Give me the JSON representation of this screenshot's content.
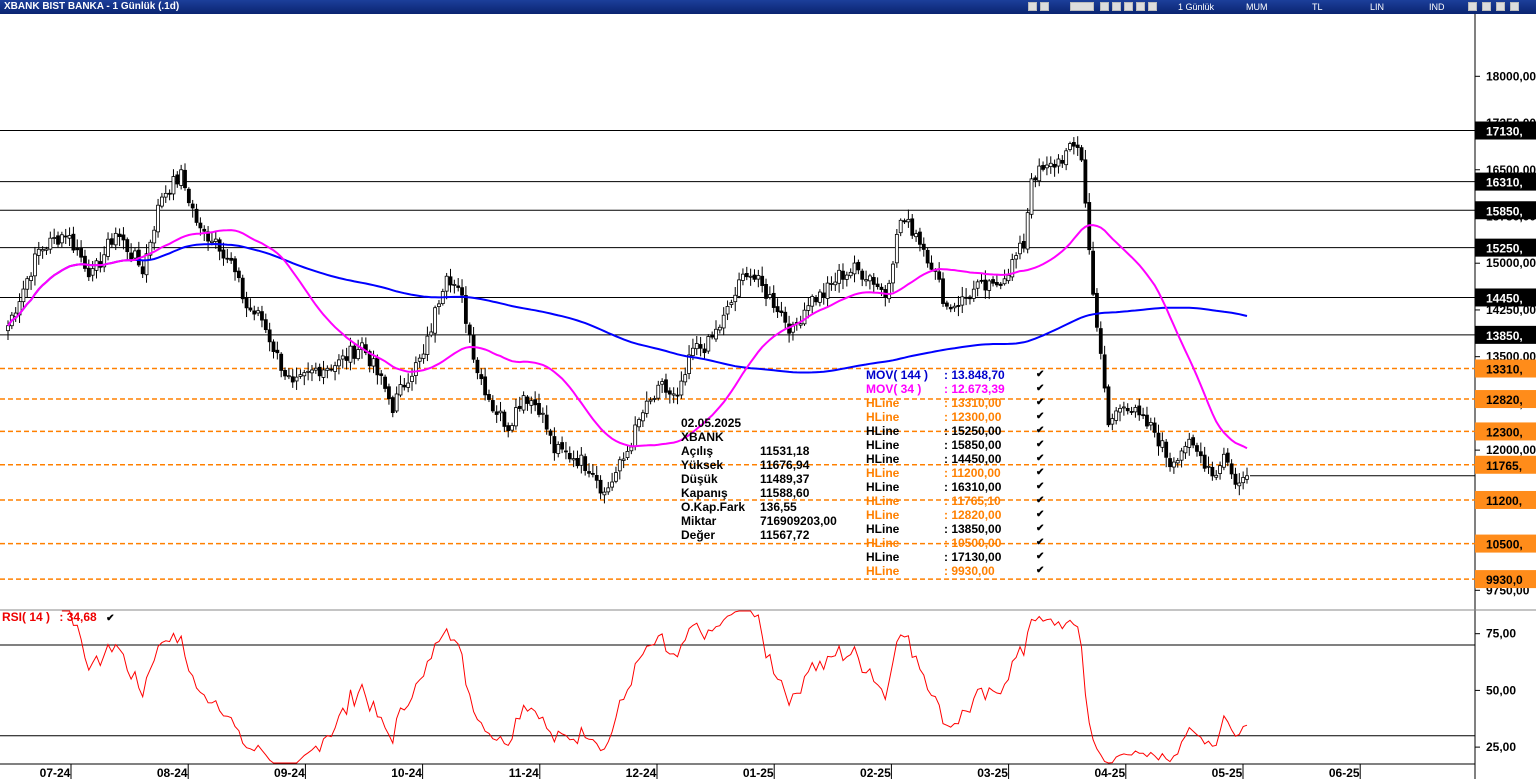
{
  "window": {
    "title": "XBANK BIST BANKA - 1 Günlük (.1d)",
    "toolbar": {
      "period": "1 Günlük",
      "style": "MUM",
      "currency": "TL",
      "scale": "LIN",
      "indicator": "IND"
    }
  },
  "colors": {
    "candle": "#000000",
    "mov144": "#0000ff",
    "mov34": "#ff00ff",
    "hline_black": "#000000",
    "hline_orange": "#ff8000",
    "rsi": "#ff0000"
  },
  "info_box": {
    "date": "02.05.2025",
    "symbol": "XBANK",
    "rows": [
      {
        "label": "Açılış",
        "value": "11531,18"
      },
      {
        "label": "Yüksek",
        "value": "11676,94"
      },
      {
        "label": "Düşük",
        "value": "11489,37"
      },
      {
        "label": "Kapanış",
        "value": "11588,60"
      },
      {
        "label": "O.Kap.Fark",
        "value": "136,55"
      },
      {
        "label": "Miktar",
        "value": "716909203,00"
      },
      {
        "label": "Değer",
        "value": "11567,72"
      }
    ]
  },
  "legend": [
    {
      "name": "MOV( 144 )",
      "value": ": 13.848,70",
      "color": "#0000cc"
    },
    {
      "name": "MOV( 34 )",
      "value": ": 12.673,39",
      "color": "#ff00ff"
    },
    {
      "name": "HLine",
      "value": ": 13310,00",
      "color": "#ff8000"
    },
    {
      "name": "HLine",
      "value": ": 12300,00",
      "color": "#ff8000"
    },
    {
      "name": "HLine",
      "value": ": 15250,00",
      "color": "#000000"
    },
    {
      "name": "HLine",
      "value": ": 15850,00",
      "color": "#000000"
    },
    {
      "name": "HLine",
      "value": ": 14450,00",
      "color": "#000000"
    },
    {
      "name": "HLine",
      "value": ": 11200,00",
      "color": "#ff8000"
    },
    {
      "name": "HLine",
      "value": ": 16310,00",
      "color": "#000000"
    },
    {
      "name": "HLine",
      "value": ": 11765,10",
      "color": "#ff8000"
    },
    {
      "name": "HLine",
      "value": ": 12820,00",
      "color": "#ff8000"
    },
    {
      "name": "HLine",
      "value": ": 13850,00",
      "color": "#000000"
    },
    {
      "name": "HLine",
      "value": ": 10500,00",
      "color": "#ff8000"
    },
    {
      "name": "HLine",
      "value": ": 17130,00",
      "color": "#000000"
    },
    {
      "name": "HLine",
      "value": ": 9930,00",
      "color": "#ff8000"
    }
  ],
  "check_mark": "✔",
  "rsi_label": {
    "name": "RSI( 14 )",
    "value": ": 34,68"
  },
  "chart_data": {
    "type": "candlestick",
    "price_ylim": [
      9450,
      19000
    ],
    "price_ticks": [
      "18000,00",
      "17250,00",
      "16500,00",
      "15750,00",
      "15000,00",
      "14250,00",
      "13500,00",
      "12750,00",
      "12000,00",
      "11250,00",
      "10500,00",
      "9750,00"
    ],
    "price_tick_values": [
      18000,
      17250,
      16500,
      15750,
      15000,
      14250,
      13500,
      12750,
      12000,
      11250,
      10500,
      9750
    ],
    "x_labels": [
      "07-24",
      "08-24",
      "09-24",
      "10-24",
      "11-24",
      "12-24",
      "01-25",
      "02-25",
      "03-25",
      "04-25",
      "05-25",
      "06-25"
    ],
    "hlines": [
      {
        "value": 17130,
        "label": "17130,",
        "style": "solid"
      },
      {
        "value": 16310,
        "label": "16310,",
        "style": "solid"
      },
      {
        "value": 15850,
        "label": "15850,",
        "style": "solid"
      },
      {
        "value": 15250,
        "label": "15250,",
        "style": "solid"
      },
      {
        "value": 14450,
        "label": "14450,",
        "style": "solid"
      },
      {
        "value": 13850,
        "label": "13850,",
        "style": "solid"
      },
      {
        "value": 13310,
        "label": "13310,",
        "style": "dashed"
      },
      {
        "value": 12820,
        "label": "12820,",
        "style": "dashed"
      },
      {
        "value": 12300,
        "label": "12300,",
        "style": "dashed"
      },
      {
        "value": 11765.1,
        "label": "11765,",
        "style": "dashed"
      },
      {
        "value": 11200,
        "label": "11200,",
        "style": "dashed"
      },
      {
        "value": 10500,
        "label": "10500,",
        "style": "dashed"
      },
      {
        "value": 9930,
        "label": "9930,0",
        "style": "dashed"
      }
    ],
    "last_price": {
      "value": 11588.6,
      "label": "11588,6"
    },
    "close_anchors": [
      [
        0,
        14000
      ],
      [
        8,
        15200
      ],
      [
        15,
        15500
      ],
      [
        22,
        14800
      ],
      [
        28,
        15500
      ],
      [
        35,
        14900
      ],
      [
        40,
        16100
      ],
      [
        45,
        16400
      ],
      [
        50,
        15500
      ],
      [
        54,
        15400
      ],
      [
        58,
        15000
      ],
      [
        62,
        14300
      ],
      [
        66,
        14100
      ],
      [
        70,
        13500
      ],
      [
        74,
        13000
      ],
      [
        80,
        13300
      ],
      [
        86,
        13400
      ],
      [
        92,
        13700
      ],
      [
        97,
        13100
      ],
      [
        100,
        12700
      ],
      [
        104,
        13200
      ],
      [
        108,
        13500
      ],
      [
        114,
        14900
      ],
      [
        118,
        14400
      ],
      [
        122,
        13300
      ],
      [
        126,
        12700
      ],
      [
        130,
        12400
      ],
      [
        134,
        12900
      ],
      [
        138,
        12700
      ],
      [
        142,
        12000
      ],
      [
        147,
        11900
      ],
      [
        152,
        11700
      ],
      [
        155,
        11300
      ],
      [
        160,
        11850
      ],
      [
        165,
        12600
      ],
      [
        170,
        13000
      ],
      [
        174,
        12800
      ],
      [
        178,
        13600
      ],
      [
        182,
        13700
      ],
      [
        186,
        14100
      ],
      [
        192,
        14900
      ],
      [
        196,
        14600
      ],
      [
        200,
        14300
      ],
      [
        204,
        13900
      ],
      [
        208,
        14400
      ],
      [
        212,
        14500
      ],
      [
        216,
        14800
      ],
      [
        220,
        14900
      ],
      [
        224,
        14800
      ],
      [
        228,
        14500
      ],
      [
        232,
        15700
      ],
      [
        236,
        15500
      ],
      [
        240,
        15000
      ],
      [
        244,
        14300
      ],
      [
        248,
        14400
      ],
      [
        252,
        14600
      ],
      [
        256,
        14600
      ],
      [
        260,
        14900
      ],
      [
        264,
        15300
      ],
      [
        266,
        16400
      ],
      [
        270,
        16500
      ],
      [
        274,
        16700
      ],
      [
        278,
        16900
      ],
      [
        279,
        16700
      ],
      [
        281,
        15200
      ],
      [
        283,
        14000
      ],
      [
        286,
        12400
      ],
      [
        290,
        12800
      ],
      [
        294,
        12500
      ],
      [
        298,
        12300
      ],
      [
        302,
        11800
      ],
      [
        306,
        12100
      ],
      [
        310,
        11900
      ],
      [
        314,
        11600
      ],
      [
        316,
        12000
      ],
      [
        318,
        11600
      ],
      [
        320,
        11450
      ],
      [
        322,
        11588.6
      ]
    ],
    "rsi_ylim": [
      18,
      85
    ],
    "rsi_ticks": [
      "75,00",
      "50,00",
      "25,00"
    ],
    "rsi_tick_values": [
      75,
      50,
      25
    ],
    "rsi_levels": [
      70,
      30
    ],
    "rsi_last": 34.68
  }
}
